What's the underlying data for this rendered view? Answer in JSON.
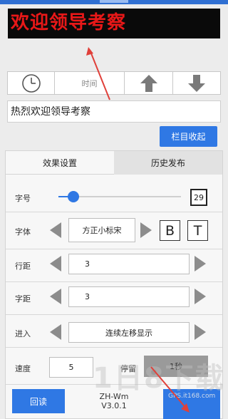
{
  "led_preview": {
    "text": "欢迎领导考察"
  },
  "time_bar": {
    "time_label": "时间"
  },
  "text_input": {
    "value": "热烈欢迎领导考察"
  },
  "collapse_button": {
    "label": "栏目收起"
  },
  "tabs": [
    {
      "label": "效果设置"
    },
    {
      "label": "历史发布"
    }
  ],
  "rows": {
    "font_size": {
      "label": "字号",
      "value": "29",
      "slider_fraction": 0.12
    },
    "font_face": {
      "label": "字体",
      "value": "方正小标宋",
      "bold_label": "B",
      "text_label": "T"
    },
    "line_spacing": {
      "label": "行距",
      "value": "3"
    },
    "char_spacing": {
      "label": "字距",
      "value": "3"
    },
    "entry": {
      "label": "进入",
      "value": "连续左移显示"
    },
    "speed": {
      "label": "速度",
      "value": "5"
    },
    "stay": {
      "label": "停留",
      "value": "1秒"
    }
  },
  "footer": {
    "reread_label": "回读",
    "app_name": "ZH-Wm",
    "version": "V3.0.1"
  },
  "watermark": {
    "main": "1日8下载",
    "sub": "GPS.it168.com"
  },
  "colors": {
    "accent": "#2f78e4",
    "led_text": "#e81818",
    "annotation_arrow": "#e0403a"
  }
}
